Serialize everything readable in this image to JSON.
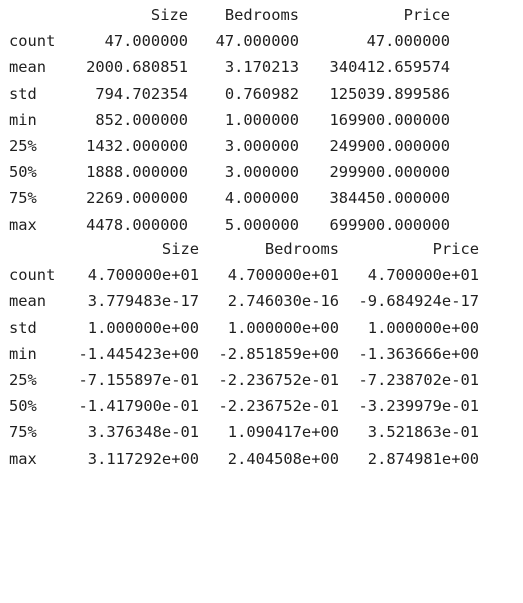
{
  "table1": {
    "headers": [
      "Size",
      "Bedrooms",
      "Price"
    ],
    "rows": [
      {
        "index": "count",
        "values": [
          "47.000000",
          "47.000000",
          "47.000000"
        ]
      },
      {
        "index": "mean",
        "values": [
          "2000.680851",
          "3.170213",
          "340412.659574"
        ]
      },
      {
        "index": "std",
        "values": [
          "794.702354",
          "0.760982",
          "125039.899586"
        ]
      },
      {
        "index": "min",
        "values": [
          "852.000000",
          "1.000000",
          "169900.000000"
        ]
      },
      {
        "index": "25%",
        "values": [
          "1432.000000",
          "3.000000",
          "249900.000000"
        ]
      },
      {
        "index": "50%",
        "values": [
          "1888.000000",
          "3.000000",
          "299900.000000"
        ]
      },
      {
        "index": "75%",
        "values": [
          "2269.000000",
          "4.000000",
          "384450.000000"
        ]
      },
      {
        "index": "max",
        "values": [
          "4478.000000",
          "5.000000",
          "699900.000000"
        ]
      }
    ]
  },
  "table2": {
    "headers": [
      "Size",
      "Bedrooms",
      "Price"
    ],
    "rows": [
      {
        "index": "count",
        "values": [
          "4.700000e+01",
          "4.700000e+01",
          "4.700000e+01"
        ]
      },
      {
        "index": "mean",
        "values": [
          "3.779483e-17",
          "2.746030e-16",
          "-9.684924e-17"
        ]
      },
      {
        "index": "std",
        "values": [
          "1.000000e+00",
          "1.000000e+00",
          "1.000000e+00"
        ]
      },
      {
        "index": "min",
        "values": [
          "-1.445423e+00",
          "-2.851859e+00",
          "-1.363666e+00"
        ]
      },
      {
        "index": "25%",
        "values": [
          "-7.155897e-01",
          "-2.236752e-01",
          "-7.238702e-01"
        ]
      },
      {
        "index": "50%",
        "values": [
          "-1.417900e-01",
          "-2.236752e-01",
          "-3.239979e-01"
        ]
      },
      {
        "index": "75%",
        "values": [
          "3.376348e-01",
          "1.090417e+00",
          "3.521863e-01"
        ]
      },
      {
        "index": "max",
        "values": [
          "3.117292e+00",
          "2.404508e+00",
          "2.874981e+00"
        ]
      }
    ]
  }
}
